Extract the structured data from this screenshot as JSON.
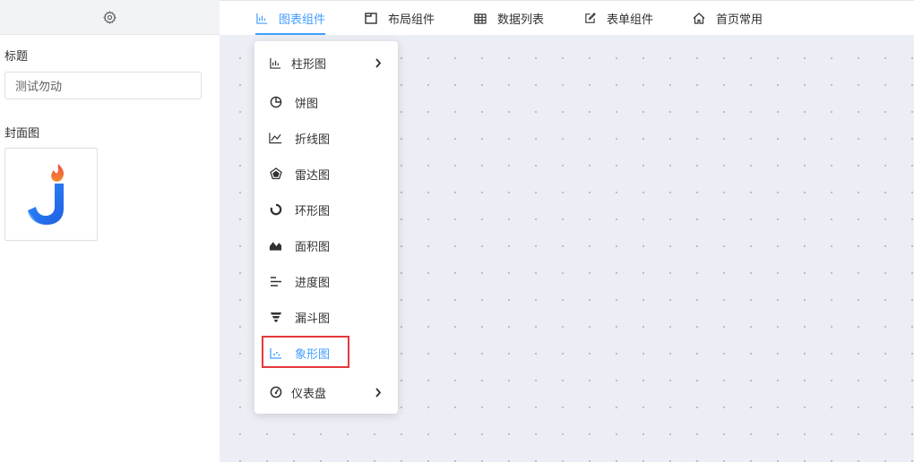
{
  "sidebar": {
    "title_label": "标题",
    "title_value": "测试勿动",
    "cover_label": "封面图"
  },
  "tabs": [
    {
      "label": "图表组件",
      "icon": "bar-chart-icon",
      "active": true
    },
    {
      "label": "布局组件",
      "icon": "layout-icon"
    },
    {
      "label": "数据列表",
      "icon": "table-icon"
    },
    {
      "label": "表单组件",
      "icon": "form-edit-icon"
    },
    {
      "label": "首页常用",
      "icon": "home-icon"
    }
  ],
  "menu": {
    "items": [
      {
        "label": "柱形图",
        "icon": "bar-chart-icon",
        "has_submenu": true
      },
      {
        "label": "饼图",
        "icon": "pie-chart-icon"
      },
      {
        "label": "折线图",
        "icon": "line-chart-icon"
      },
      {
        "label": "雷达图",
        "icon": "radar-chart-icon"
      },
      {
        "label": "环形图",
        "icon": "ring-chart-icon"
      },
      {
        "label": "面积图",
        "icon": "area-chart-icon"
      },
      {
        "label": "进度图",
        "icon": "progress-chart-icon"
      },
      {
        "label": "漏斗图",
        "icon": "funnel-chart-icon"
      },
      {
        "label": "象形图",
        "icon": "pictorial-chart-icon",
        "highlighted": true
      },
      {
        "label": "仪表盘",
        "icon": "gauge-icon",
        "has_submenu": true
      }
    ]
  },
  "colors": {
    "accent": "#409eff",
    "highlight_border": "#e5383b",
    "canvas_bg": "#eceef5"
  }
}
